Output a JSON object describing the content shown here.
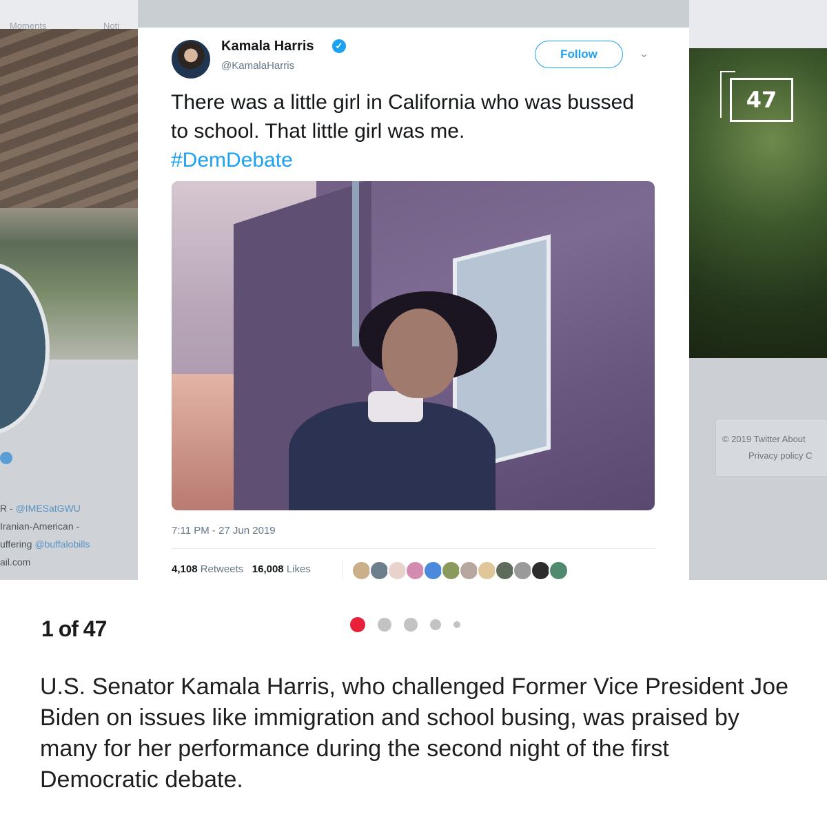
{
  "background_left": {
    "topbar_items": [
      "Moments",
      "Noti"
    ],
    "bio_lines": [
      {
        "prefix": "R - ",
        "link": "@IMESatGWU"
      },
      {
        "prefix": "Iranian-American -",
        "link": ""
      },
      {
        "prefix": "uffering ",
        "link": "@buffalobills"
      },
      {
        "prefix": "ail.com",
        "link": ""
      }
    ]
  },
  "background_right": {
    "footer_line1": "© 2019 Twitter   About",
    "footer_line2": "Privacy policy   C"
  },
  "slide_counter_badge": "47",
  "tweet": {
    "author_name": "Kamala Harris",
    "author_handle": "@KamalaHarris",
    "verified_mark": "✓",
    "follow_label": "Follow",
    "menu_chevron": "⌄",
    "text": "There was a little girl in California who was bussed to school. That little girl was me.",
    "hashtag": "#DemDebate",
    "timestamp": "7:11 PM - 27 Jun 2019",
    "retweets_count": "4,108",
    "retweets_label": "Retweets",
    "likes_count": "16,008",
    "likes_label": "Likes",
    "liker_colors": [
      "#c9b08a",
      "#6b7f8c",
      "#e7d3cc",
      "#d48bb0",
      "#4a89dc",
      "#8a9a5b",
      "#b7a7a0",
      "#e0c79a",
      "#5e6b5a",
      "#9a9a9a",
      "#2c2c2c",
      "#4f8a6e"
    ]
  },
  "gallery": {
    "position_label": "1 of 47",
    "dots_count": 5,
    "active_dot_index": 0,
    "active_color": "#e8213a",
    "caption": "U.S. Senator Kamala Harris, who challenged Former Vice President Joe Biden on issues like immigration and school busing, was praised by many for her performance during the second night of the first Democratic debate."
  }
}
